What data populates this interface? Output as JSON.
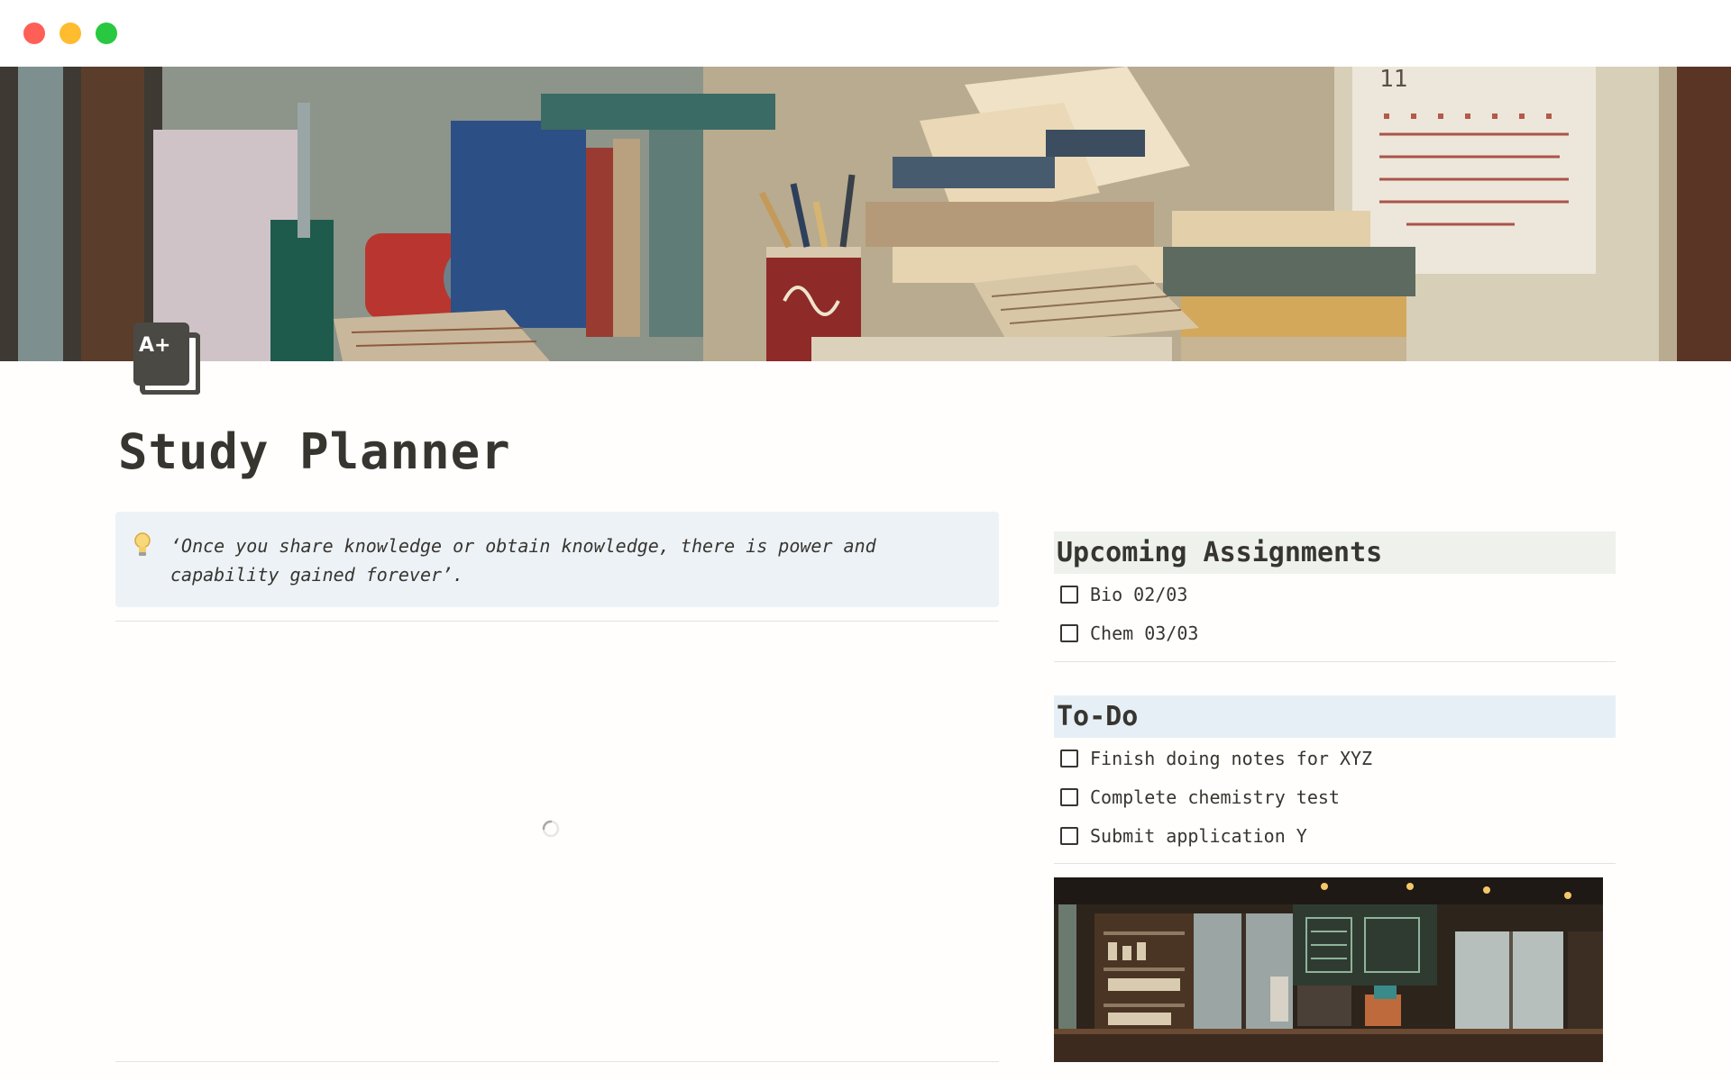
{
  "window": {
    "controls": [
      "close",
      "minimize",
      "zoom"
    ]
  },
  "cover": {
    "image": "study-desk-books-illustration",
    "calendar_number": "11"
  },
  "page": {
    "icon": "a-plus-grade-icon",
    "icon_text": "A+",
    "title": "Study Planner"
  },
  "callout": {
    "icon": "lightbulb-icon",
    "quote": "‘Once you share knowledge or obtain knowledge, there is power and capability gained forever’."
  },
  "assignments": {
    "heading": "Upcoming Assignments",
    "items": [
      {
        "label": "Bio 02/03",
        "checked": false
      },
      {
        "label": "Chem 03/03",
        "checked": false
      }
    ]
  },
  "todo": {
    "heading": "To-Do",
    "items": [
      {
        "label": "Finish doing notes for XYZ",
        "checked": false
      },
      {
        "label": "Complete chemistry test",
        "checked": false
      },
      {
        "label": "Submit application Y",
        "checked": false
      }
    ]
  },
  "gallery": {
    "image": "pixel-art-cafe-illustration"
  },
  "colors": {
    "callout_bg": "#edf2f7",
    "assignments_header_bg": "#eef1ec",
    "todo_header_bg": "#e7eff6",
    "text": "#37352f"
  }
}
